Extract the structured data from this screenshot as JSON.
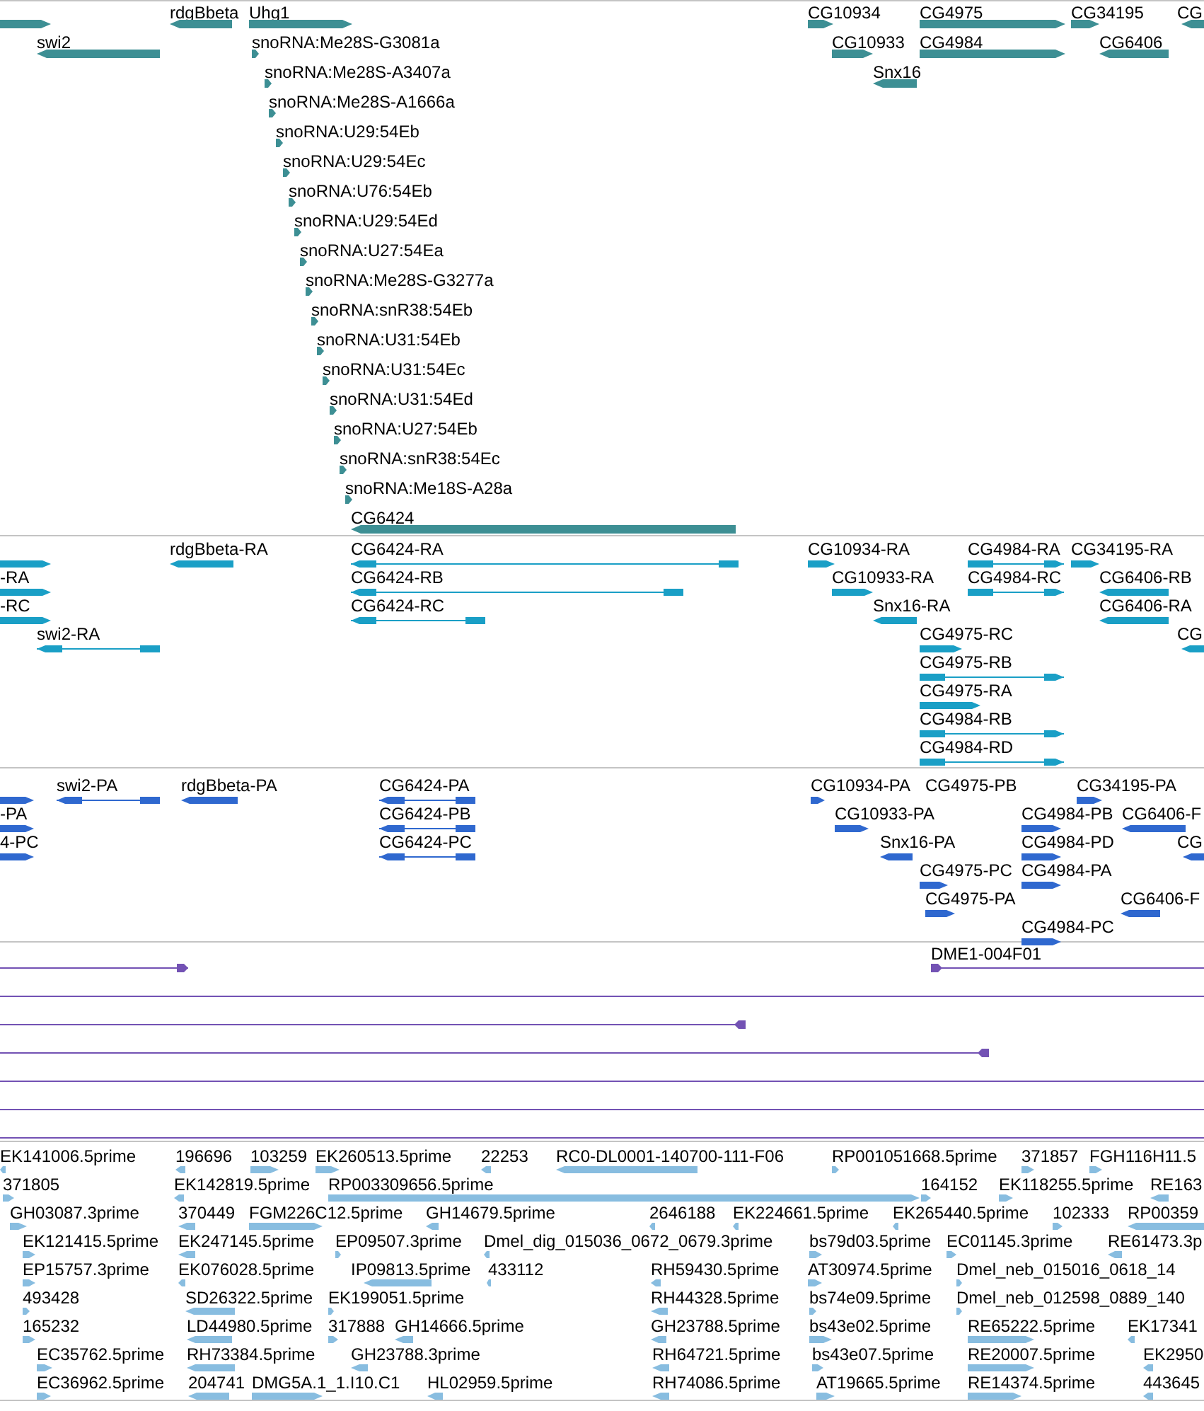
{
  "tracks": [
    {
      "kind": "bars",
      "color": "#3d8f94",
      "features": [
        {
          "reverse": false
        },
        {
          "label": "rdgBbeta",
          "reverse": true
        },
        {
          "label": "Uhg1",
          "reverse": false
        },
        {
          "label": "swi2",
          "reverse": true
        },
        {
          "label": "snoRNA:Me28S-G3081a",
          "reverse": false
        },
        {
          "label": "snoRNA:Me28S-A3407a",
          "reverse": false
        },
        {
          "label": "snoRNA:Me28S-A1666a",
          "reverse": false
        },
        {
          "label": "snoRNA:U29:54Eb",
          "reverse": false
        },
        {
          "label": "snoRNA:U29:54Ec",
          "reverse": false
        },
        {
          "label": "snoRNA:U76:54Eb",
          "reverse": false
        },
        {
          "label": "snoRNA:U29:54Ed",
          "reverse": false
        },
        {
          "label": "snoRNA:U27:54Ea",
          "reverse": false
        },
        {
          "label": "snoRNA:Me28S-G3277a",
          "reverse": false
        },
        {
          "label": "snoRNA:snR38:54Eb",
          "reverse": false
        },
        {
          "label": "snoRNA:U31:54Eb",
          "reverse": false
        },
        {
          "label": "snoRNA:U31:54Ec",
          "reverse": false
        },
        {
          "label": "snoRNA:U31:54Ed",
          "reverse": false
        },
        {
          "label": "snoRNA:U27:54Eb",
          "reverse": false
        },
        {
          "label": "snoRNA:snR38:54Ec",
          "reverse": false
        },
        {
          "label": "snoRNA:Me18S-A28a",
          "reverse": false
        },
        {
          "label": "CG6424",
          "reverse": true
        },
        {
          "label": "CG10934",
          "reverse": false
        },
        {
          "label": "CG10933",
          "reverse": false
        },
        {
          "label": "Snx16",
          "reverse": true
        },
        {
          "label": "CG4975",
          "reverse": false
        },
        {
          "label": "CG4984",
          "reverse": false
        },
        {
          "label": "CG34195",
          "reverse": false
        },
        {
          "label": "CG6406",
          "reverse": true
        },
        {
          "label": "CG",
          "reverse": true
        }
      ]
    },
    {
      "kind": "bars",
      "color": "#1a9fc6",
      "features": [
        {
          "reverse": false
        },
        {
          "label": "-RA",
          "reverse": false
        },
        {
          "label": "-RC",
          "reverse": false
        },
        {
          "label": "swi2-RA",
          "reverse": true
        },
        {
          "label": "rdgBbeta-RA",
          "reverse": true
        },
        {
          "label": "CG6424-RA",
          "reverse": true
        },
        {
          "label": "CG6424-RB",
          "reverse": true
        },
        {
          "label": "CG6424-RC",
          "reverse": true
        },
        {
          "label": "CG10934-RA",
          "reverse": false
        },
        {
          "label": "CG10933-RA",
          "reverse": false
        },
        {
          "label": "Snx16-RA",
          "reverse": true
        },
        {
          "label": "CG4984-RA",
          "reverse": false
        },
        {
          "label": "CG34195-RA",
          "reverse": false
        },
        {
          "label": "CG4984-RC",
          "reverse": false
        },
        {
          "label": "CG6406-RB",
          "reverse": true
        },
        {
          "label": "CG6406-RA",
          "reverse": true
        },
        {
          "label": "CG4975-RC",
          "reverse": false
        },
        {
          "label": "CG",
          "reverse": true
        },
        {
          "label": "CG4975-RB",
          "reverse": false
        },
        {
          "label": "CG4975-RA",
          "reverse": false
        },
        {
          "label": "CG4984-RB",
          "reverse": false
        },
        {
          "label": "CG4984-RD",
          "reverse": false
        }
      ]
    },
    {
      "kind": "bars",
      "color": "#2f68cf",
      "features": [
        {
          "reverse": false
        },
        {
          "label": "-PA",
          "reverse": false
        },
        {
          "label": "4-PC",
          "reverse": false
        },
        {
          "label": "swi2-PA",
          "reverse": true
        },
        {
          "label": "rdgBbeta-PA",
          "reverse": true
        },
        {
          "label": "CG6424-PA",
          "reverse": true
        },
        {
          "label": "CG6424-PB",
          "reverse": true
        },
        {
          "label": "CG6424-PC",
          "reverse": true
        },
        {
          "label": "CG10934-PA",
          "reverse": false
        },
        {
          "label": "CG4975-PB"
        },
        {
          "label": "CG34195-PA",
          "reverse": false
        },
        {
          "label": "CG10933-PA",
          "reverse": false
        },
        {
          "label": "CG4984-PB",
          "reverse": false
        },
        {
          "label": "CG6406-F",
          "reverse": true
        },
        {
          "label": "Snx16-PA",
          "reverse": true
        },
        {
          "label": "CG4984-PD",
          "reverse": false
        },
        {
          "label": "CG",
          "reverse": true
        },
        {
          "label": "CG4975-PC",
          "reverse": false
        },
        {
          "label": "CG4984-PA",
          "reverse": false
        },
        {
          "label": "CG4975-PA",
          "reverse": false
        },
        {
          "label": "CG6406-F",
          "reverse": true
        },
        {
          "label": "CG4984-PC",
          "reverse": false
        }
      ]
    },
    {
      "kind": "lines",
      "color": "#7352b4",
      "features": [
        {
          "kind": "end",
          "reverse": false
        },
        {
          "kind": "end",
          "label": "DME1-004F01",
          "reverse": false
        },
        {
          "kind": "span"
        },
        {
          "kind": "end",
          "reverse": true
        },
        {
          "kind": "end",
          "reverse": true
        },
        {
          "kind": "span"
        },
        {
          "kind": "span"
        },
        {
          "kind": "span"
        }
      ]
    },
    {
      "kind": "bars",
      "color": "#88bde0",
      "features": [
        {
          "label": "EK141006.5prime",
          "reverse": true
        },
        {
          "label": "196696",
          "reverse": true
        },
        {
          "label": "103259",
          "reverse": false
        },
        {
          "label": "EK260513.5prime",
          "reverse": false
        },
        {
          "label": "22253",
          "reverse": true
        },
        {
          "label": "RC0-DL0001-140700-111-F06",
          "reverse": true
        },
        {
          "label": "RP001051668.5prime",
          "reverse": false
        },
        {
          "label": "371857",
          "reverse": false
        },
        {
          "label": "FGH116H11.5",
          "reverse": false
        },
        {
          "label": "371805",
          "reverse": false
        },
        {
          "label": "EK142819.5prime",
          "reverse": true
        },
        {
          "label": "RP003309656.5prime",
          "reverse": false
        },
        {
          "label": "164152",
          "reverse": false
        },
        {
          "label": "EK118255.5prime",
          "reverse": false
        },
        {
          "label": "RE163",
          "reverse": true
        },
        {
          "label": "GH03087.3prime",
          "reverse": false
        },
        {
          "label": "370449",
          "reverse": true
        },
        {
          "label": "FGM226C12.5prime",
          "reverse": false
        },
        {
          "label": "GH14679.5prime",
          "reverse": true
        },
        {
          "label": "2646188",
          "reverse": true
        },
        {
          "label": "EK224661.5prime",
          "reverse": true
        },
        {
          "label": "EK265440.5prime",
          "reverse": true
        },
        {
          "label": "102333",
          "reverse": false
        },
        {
          "label": "RP00359",
          "reverse": true
        },
        {
          "label": "EK121415.5prime",
          "reverse": false
        },
        {
          "label": "EK247145.5prime",
          "reverse": true
        },
        {
          "label": "EP09507.3prime",
          "reverse": false
        },
        {
          "label": "Dmel_dig_015036_0672_0679.3prime",
          "reverse": true
        },
        {
          "label": "bs79d03.5prime",
          "reverse": false
        },
        {
          "label": "EC01145.3prime",
          "reverse": false
        },
        {
          "label": "RE61473.3p",
          "reverse": true
        },
        {
          "label": "EP15757.3prime",
          "reverse": false
        },
        {
          "label": "EK076028.5prime",
          "reverse": true
        },
        {
          "label": "IP09813.5prime",
          "reverse": true
        },
        {
          "label": "433112",
          "reverse": true
        },
        {
          "label": "RH59430.5prime",
          "reverse": true
        },
        {
          "label": "AT30974.5prime",
          "reverse": false
        },
        {
          "label": "Dmel_neb_015016_0618_14",
          "reverse": false
        },
        {
          "label": "493428",
          "reverse": false
        },
        {
          "label": "SD26322.5prime",
          "reverse": true
        },
        {
          "label": "EK199051.5prime",
          "reverse": false
        },
        {
          "label": "RH44328.5prime",
          "reverse": true
        },
        {
          "label": "bs74e09.5prime",
          "reverse": false
        },
        {
          "label": "Dmel_neb_012598_0889_140",
          "reverse": false
        },
        {
          "label": "165232",
          "reverse": false
        },
        {
          "label": "LD44980.5prime",
          "reverse": true
        },
        {
          "label": "317888",
          "reverse": false
        },
        {
          "label": "GH14666.5prime",
          "reverse": true
        },
        {
          "label": "GH23788.5prime",
          "reverse": true
        },
        {
          "label": "bs43e02.5prime",
          "reverse": false
        },
        {
          "label": "RE65222.5prime",
          "reverse": false
        },
        {
          "label": "EK17341",
          "reverse": true
        },
        {
          "label": "EC35762.5prime",
          "reverse": false
        },
        {
          "label": "RH73384.5prime",
          "reverse": true
        },
        {
          "label": "GH23788.3prime",
          "reverse": true
        },
        {
          "label": "RH64721.5prime",
          "reverse": true
        },
        {
          "label": "bs43e07.5prime",
          "reverse": false
        },
        {
          "label": "RE20007.5prime",
          "reverse": false
        },
        {
          "label": "EK2950",
          "reverse": true
        },
        {
          "label": "EC36962.5prime",
          "reverse": false
        },
        {
          "label": "204741",
          "reverse": true
        },
        {
          "label": "DMG5A.1_1.I10.C1",
          "reverse": false
        },
        {
          "label": "HL02959.5prime",
          "reverse": true
        },
        {
          "label": "RH74086.5prime",
          "reverse": true
        },
        {
          "label": "AT19665.5prime",
          "reverse": false
        },
        {
          "label": "RE14374.5prime",
          "reverse": false
        },
        {
          "label": "443645",
          "reverse": true
        }
      ]
    }
  ]
}
